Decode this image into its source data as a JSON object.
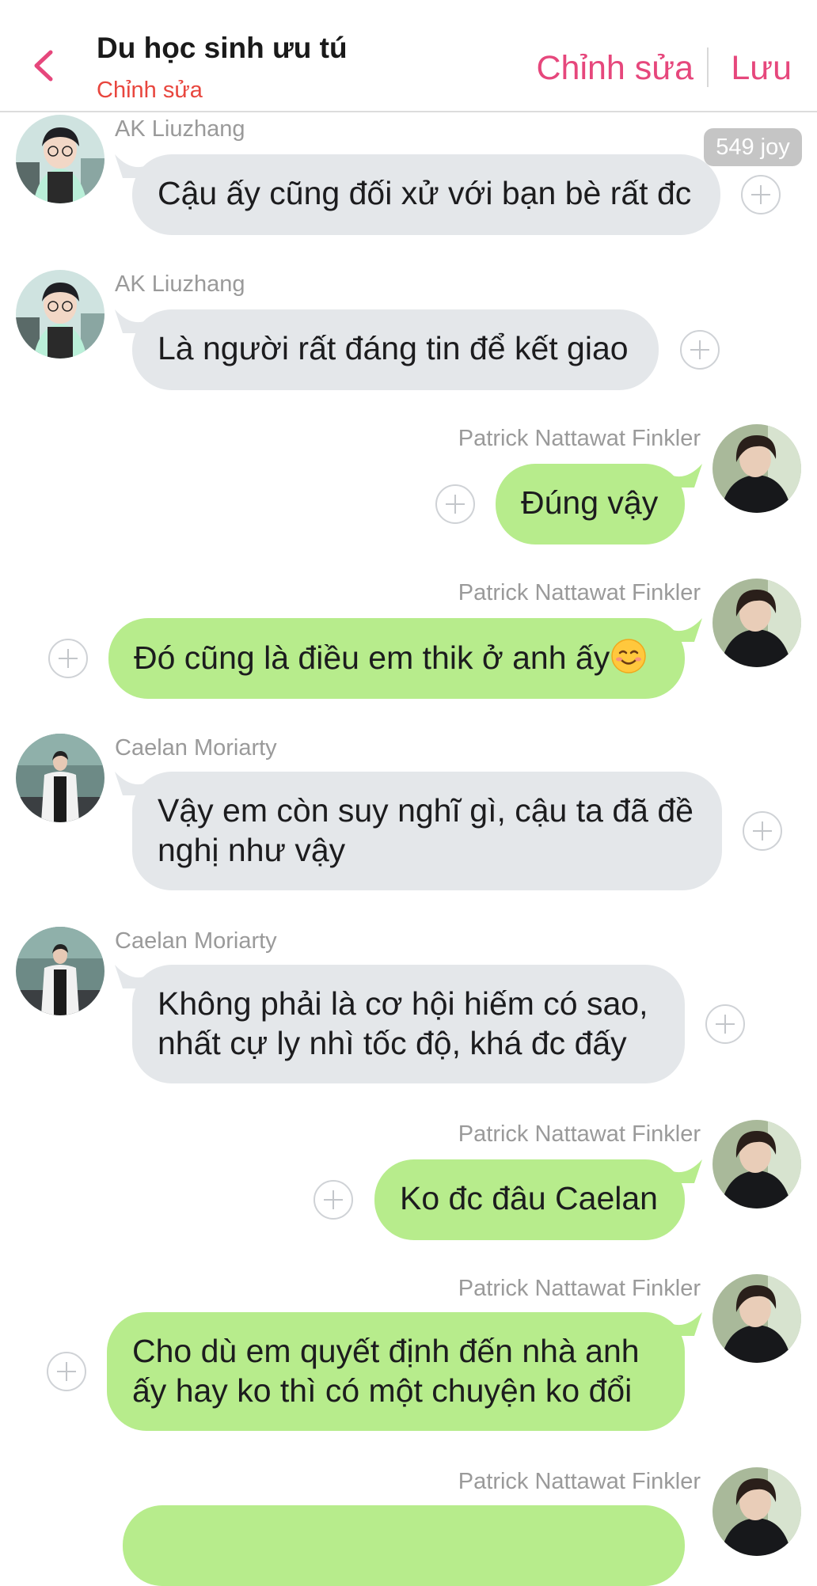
{
  "header": {
    "title": "Du học sinh ưu tú",
    "subtitle": "Chỉnh sửa",
    "edit_label": "Chỉnh sửa",
    "save_label": "Lưu",
    "accent_color": "#e6477c",
    "subtitle_color": "#e8463e"
  },
  "joy_badge": "549 joy",
  "colors": {
    "incoming_bubble": "#e4e7ea",
    "outgoing_bubble": "#b7ec8c"
  },
  "messages": [
    {
      "sender": "AK Liuzhang",
      "side": "left",
      "lines": [
        "Cậu ấy cũng đối xử với bạn bè rất đc"
      ]
    },
    {
      "sender": "AK Liuzhang",
      "side": "left",
      "lines": [
        "Là người rất đáng tin để kết giao"
      ]
    },
    {
      "sender": "Patrick Nattawat Finkler",
      "side": "right",
      "lines": [
        "Đúng vậy"
      ]
    },
    {
      "sender": "Patrick Nattawat Finkler",
      "side": "right",
      "lines": [
        "Đó cũng là điều em thik ở anh ấy"
      ],
      "emoji": "smiling-face-emoji"
    },
    {
      "sender": "Caelan Moriarty",
      "side": "left",
      "lines": [
        "Vậy em còn suy nghĩ gì, cậu ta đã đề",
        "nghị như vậy"
      ]
    },
    {
      "sender": "Caelan Moriarty",
      "side": "left",
      "lines": [
        "Không phải là cơ hội hiếm có sao,",
        "nhất cự ly nhì tốc độ, khá đc đấy"
      ]
    },
    {
      "sender": "Patrick Nattawat Finkler",
      "side": "right",
      "lines": [
        "Ko đc đâu Caelan"
      ]
    },
    {
      "sender": "Patrick Nattawat Finkler",
      "side": "right",
      "lines": [
        "Cho dù em quyết định đến nhà anh",
        "ấy hay ko thì có một chuyện ko đổi"
      ]
    },
    {
      "sender": "Patrick Nattawat Finkler",
      "side": "right",
      "lines": []
    }
  ]
}
